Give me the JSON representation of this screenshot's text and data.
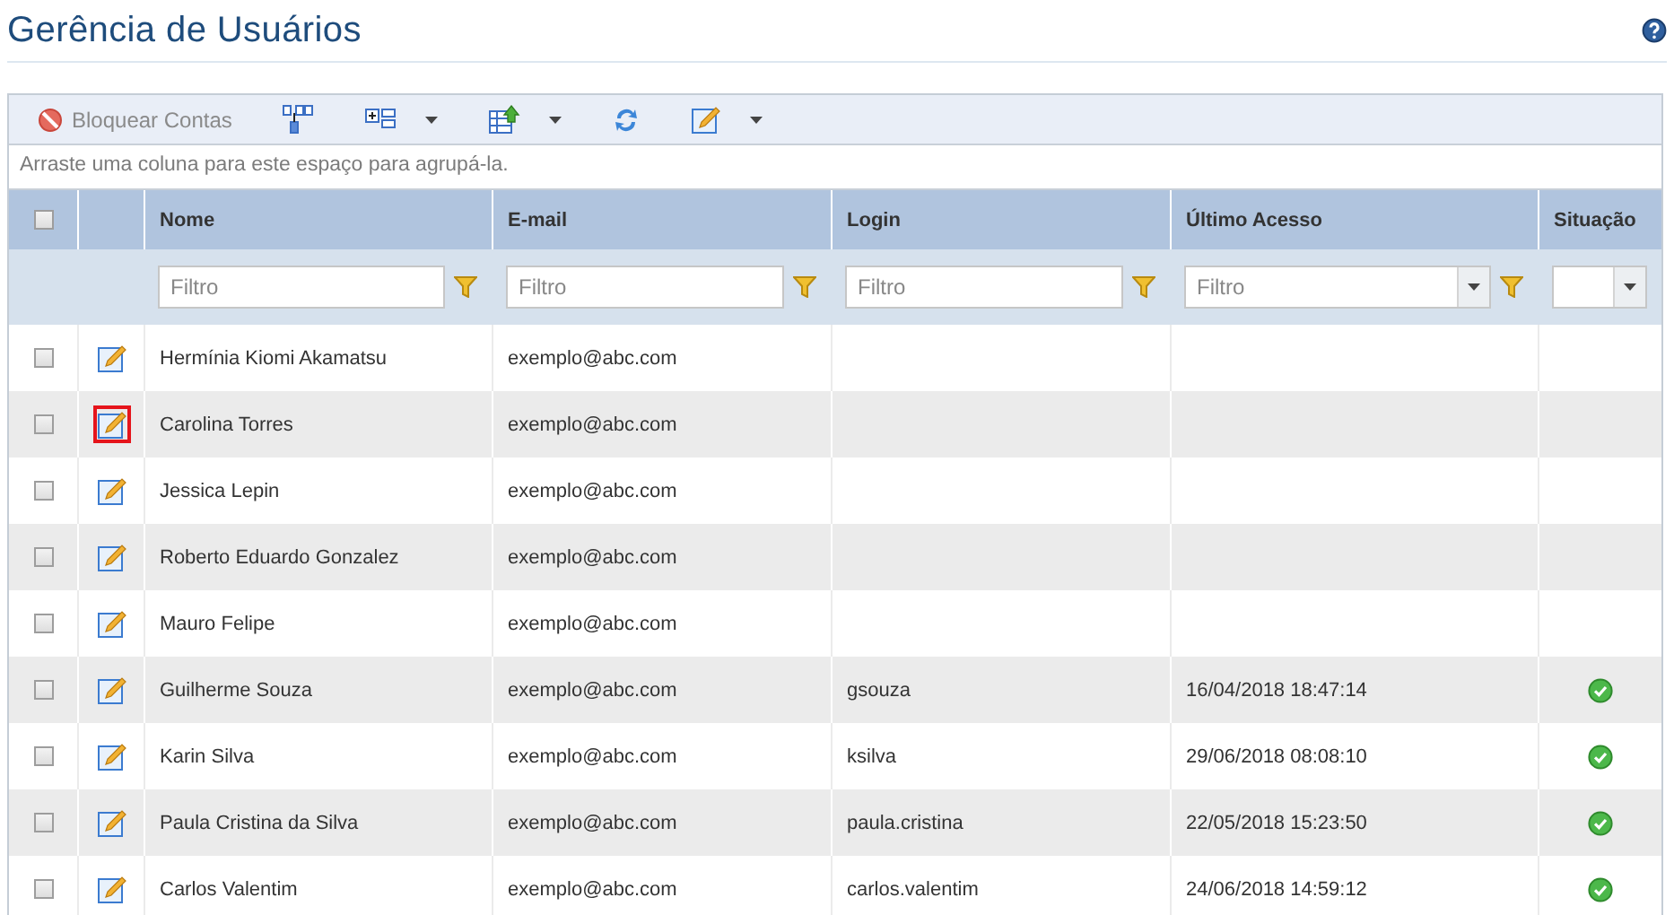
{
  "title": "Gerência de Usuários",
  "toolbar": [
    {
      "kind": "block",
      "label": "Bloquear Contas",
      "disabled": true,
      "dropdown": false
    },
    {
      "kind": "hierarchy",
      "dropdown": false
    },
    {
      "kind": "columns",
      "dropdown": true
    },
    {
      "kind": "export",
      "dropdown": true
    },
    {
      "kind": "refresh",
      "dropdown": false
    },
    {
      "kind": "edit",
      "dropdown": true
    }
  ],
  "group_hint": "Arraste uma coluna para este espaço para agrupá-la.",
  "header_checked": false,
  "columns": [
    {
      "label": "Nome"
    },
    {
      "label": "E-mail"
    },
    {
      "label": "Login"
    },
    {
      "label": "Último Acesso"
    },
    {
      "label": "Situação"
    }
  ],
  "filters": [
    {
      "kind": "text",
      "placeholder": "Filtro"
    },
    {
      "kind": "text",
      "placeholder": "Filtro"
    },
    {
      "kind": "text",
      "placeholder": "Filtro"
    },
    {
      "kind": "combo",
      "placeholder": "Filtro"
    },
    {
      "kind": "select"
    }
  ],
  "rows": [
    {
      "checked": false,
      "highlighted": false,
      "name": "Hermínia Kiomi Akamatsu",
      "email": "exemplo@abc.com",
      "active": false
    },
    {
      "checked": false,
      "highlighted": true,
      "name": "Carolina Torres",
      "email": "exemplo@abc.com",
      "active": false
    },
    {
      "checked": false,
      "highlighted": false,
      "name": "Jessica Lepin",
      "email": "exemplo@abc.com",
      "active": false
    },
    {
      "checked": false,
      "highlighted": false,
      "name": "Roberto Eduardo Gonzalez",
      "email": "exemplo@abc.com",
      "active": false
    },
    {
      "checked": false,
      "highlighted": false,
      "name": "Mauro Felipe",
      "email": "exemplo@abc.com",
      "active": false
    },
    {
      "checked": false,
      "highlighted": false,
      "name": "Guilherme Souza",
      "email": "exemplo@abc.com",
      "login": "gsouza",
      "last_access": "16/04/2018 18:47:14",
      "active": true
    },
    {
      "checked": false,
      "highlighted": false,
      "name": "Karin Silva",
      "email": "exemplo@abc.com",
      "login": "ksilva",
      "last_access": "29/06/2018 08:08:10",
      "active": true
    },
    {
      "checked": false,
      "highlighted": false,
      "name": "Paula Cristina da Silva",
      "email": "exemplo@abc.com",
      "login": "paula.cristina",
      "last_access": "22/05/2018 15:23:50",
      "active": true
    },
    {
      "checked": false,
      "highlighted": false,
      "name": "Carlos Valentim",
      "email": "exemplo@abc.com",
      "login": "carlos.valentim",
      "last_access": "24/06/2018 14:59:12",
      "active": true
    }
  ]
}
